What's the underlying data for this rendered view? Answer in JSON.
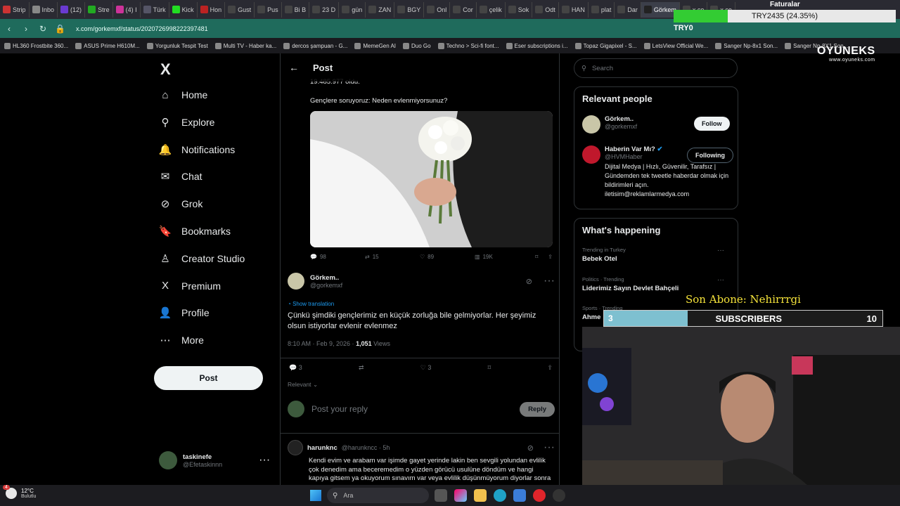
{
  "browser": {
    "tabs": [
      "Strip",
      "Inbo",
      "(12)",
      "Stre",
      "(4) I",
      "Türk",
      "Kick",
      "Hon",
      "Gust",
      "Pus",
      "Bi B",
      "23 D",
      "gün",
      "ZAN",
      "BGY",
      "Onl",
      "Cor",
      "çelik",
      "Sok",
      "Odt",
      "HAN",
      "plat",
      "Dar",
      "Görkem",
      "x.co",
      "x.co"
    ],
    "active_tab_index": 23,
    "url": "x.com/gorkemxf/status/2020726998222397481",
    "bookmarks": [
      "HL360 Frostbite 360...",
      "ASUS Prime H610M...",
      "Yorgunluk Tespit Test",
      "Multi TV - Haber ka...",
      "dercos şampuan - G...",
      "MemeGen AI",
      "Duo Go",
      "Techno > Sci-fi font...",
      "Eser subscriptions i...",
      "Topaz Gigapixel - S...",
      "LetsView Official We...",
      "Sanger Np-8x1 Son...",
      "Sanger Np-8X1 Son..."
    ]
  },
  "sidebar": {
    "logo": "X",
    "items": [
      {
        "label": "Home",
        "icon": "home-icon",
        "glyph": "⌂"
      },
      {
        "label": "Explore",
        "icon": "search-icon",
        "glyph": "⚲"
      },
      {
        "label": "Notifications",
        "icon": "bell-icon",
        "glyph": "🔔"
      },
      {
        "label": "Chat",
        "icon": "mail-icon",
        "glyph": "✉"
      },
      {
        "label": "Grok",
        "icon": "grok-icon",
        "glyph": "⊘"
      },
      {
        "label": "Bookmarks",
        "icon": "bookmark-icon",
        "glyph": "🔖"
      },
      {
        "label": "Creator Studio",
        "icon": "creator-icon",
        "glyph": "♙"
      },
      {
        "label": "Premium",
        "icon": "x-premium-icon",
        "glyph": "X"
      },
      {
        "label": "Profile",
        "icon": "person-icon",
        "glyph": "👤"
      },
      {
        "label": "More",
        "icon": "more-circle-icon",
        "glyph": "⋯"
      }
    ],
    "post_button": "Post",
    "account": {
      "name": "taskinefe",
      "handle": "@Efetaskinnn"
    }
  },
  "main": {
    "header_title": "Post",
    "quoted": {
      "line1": "19.485.977 oldu.",
      "line2": "Gençlere soruyoruz: Neden evlenmiyorsunuz?",
      "stats": {
        "replies": "98",
        "reposts": "15",
        "likes": "89",
        "views": "19K"
      }
    },
    "post": {
      "name": "Görkem..",
      "handle": "@gorkemxf",
      "show_translation": "Show translation",
      "text": "Çünkü şimdiki gençlerimiz en küçük zorluğa bile gelmiyorlar. Her şeyimiz olsun istiyorlar evlenir evlenmez",
      "time": "8:10 AM · Feb 9, 2026 · ",
      "views_count": "1,051",
      "views_label": " Views",
      "replies": "3",
      "likes": "3",
      "sort_label": "Relevant"
    },
    "reply_box": {
      "placeholder": "Post your reply",
      "button": "Reply"
    },
    "comment": {
      "name": "harunknc",
      "handle": "@harunkncc · 5h",
      "text": "Kendi evim ve arabam var işimde gayet yerinde lakin ben sevgili yolundan evlilik çok denedim ama beceremedim o yüzden görücü usulüne döndüm ve hangi kapıya gitsem ya okuyorum sınavım var veya evlilik düşünmüyorum diyorlar sonra en küçük zorluğu aşamayacak bir şefete mi cabilim"
    }
  },
  "right": {
    "search_placeholder": "Search",
    "relevant_title": "Relevant people",
    "people": [
      {
        "name": "Görkem..",
        "handle": "@gorkemxf",
        "button": "Follow",
        "bio": ""
      },
      {
        "name": "Haberin Var Mı?",
        "handle": "@HVMHaber",
        "button": "Following",
        "bio": "Dijital Medya | Hızlı, Güvenilir, Tarafsız | Gündemden tek tweetle haberdar olmak için bildirimleri açın. iletisim@reklamlarmedya.com"
      }
    ],
    "happening_title": "What's happening",
    "trends": [
      {
        "category": "Trending in Turkey",
        "title": "Bebek Otel"
      },
      {
        "category": "Politics · Trending",
        "title": "Liderimiz Sayın Devlet Bahçeli"
      },
      {
        "category": "Sports · Trending",
        "title": "Ahme"
      }
    ]
  },
  "stream_overlay": {
    "money_label": "Faturalar",
    "money_text": "TRY2435 (24.35%)",
    "money_percent": 24.35,
    "try0": "TRY0",
    "brand": "OYUNEKS",
    "brand_sub": "www.oyuneks.com",
    "son_abone": "Son Abone: Nehirrrgi",
    "sub_current": "3",
    "sub_label": "SUBSCRIBERS",
    "sub_goal": "10",
    "sub_fraction": 0.3
  },
  "taskbar": {
    "weather_temp": "12°C",
    "weather_desc": "Bulutlu",
    "notification_count": "4",
    "search_placeholder": "Ara"
  },
  "colors": {
    "accent_green": "#1f6b5c",
    "verified": "#1d9bf0",
    "bg": "#000000"
  }
}
